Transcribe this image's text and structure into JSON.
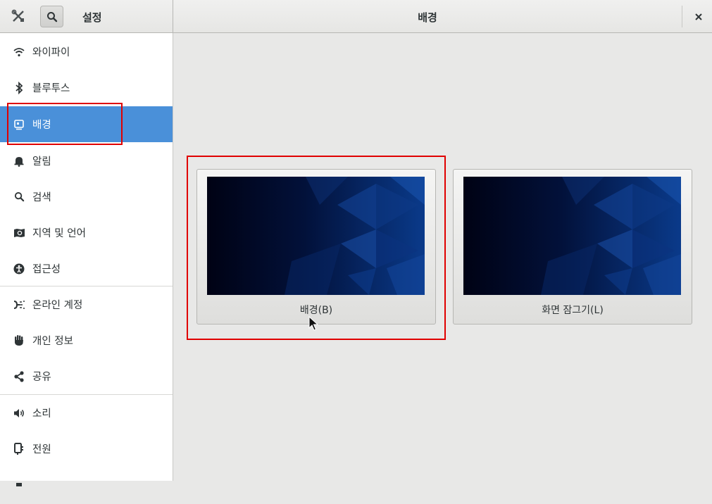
{
  "header": {
    "app_title": "설정",
    "panel_title": "배경"
  },
  "sidebar": {
    "items": [
      {
        "label": "와이파이",
        "icon": "wifi-icon"
      },
      {
        "label": "블루투스",
        "icon": "bluetooth-icon"
      },
      {
        "label": "배경",
        "icon": "background-icon",
        "selected": true
      },
      {
        "label": "알림",
        "icon": "bell-icon"
      },
      {
        "label": "검색",
        "icon": "search-icon"
      },
      {
        "label": "지역 및 언어",
        "icon": "region-icon"
      },
      {
        "label": "접근성",
        "icon": "accessibility-icon"
      },
      {
        "label": "온라인 계정",
        "icon": "online-accounts-icon"
      },
      {
        "label": "개인 정보",
        "icon": "privacy-hand-icon"
      },
      {
        "label": "공유",
        "icon": "share-icon"
      },
      {
        "label": "소리",
        "icon": "speaker-icon"
      },
      {
        "label": "전원",
        "icon": "power-plug-icon"
      }
    ]
  },
  "main": {
    "cards": [
      {
        "label": "배경(B)"
      },
      {
        "label": "화면 잠그기(L)"
      }
    ]
  },
  "colors": {
    "accent": "#4a90d9",
    "highlight": "#e00000",
    "wallpaper_dark": "#000a2a",
    "wallpaper_blue": "#0b3a8c"
  }
}
